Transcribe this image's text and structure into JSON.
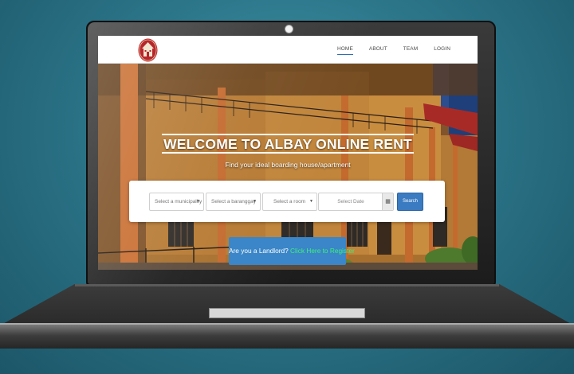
{
  "colors": {
    "background": "#2c7589",
    "accent": "#3a7bc1",
    "register_link": "#3df07a",
    "nav_active_underline": "#2f6fb0"
  },
  "site": {
    "logo_icon": "house-icon",
    "nav": [
      {
        "label": "HOME",
        "active": true
      },
      {
        "label": "ABOUT",
        "active": false
      },
      {
        "label": "TEAM",
        "active": false
      },
      {
        "label": "LOGIN",
        "active": false
      }
    ]
  },
  "hero": {
    "title": "WELCOME TO ALBAY ONLINE RENT",
    "subtitle": "Find your ideal boarding house/apartment"
  },
  "search": {
    "municipality_placeholder": "Select a municipality",
    "barangay_placeholder": "Select a baranggay",
    "room_placeholder": "Select a room",
    "date_placeholder": "Select Date",
    "calendar_icon": "calendar-icon",
    "button_label": "Search"
  },
  "landlord": {
    "prompt": "Are you a Landlord?",
    "link_text": "Click Here to Register"
  }
}
